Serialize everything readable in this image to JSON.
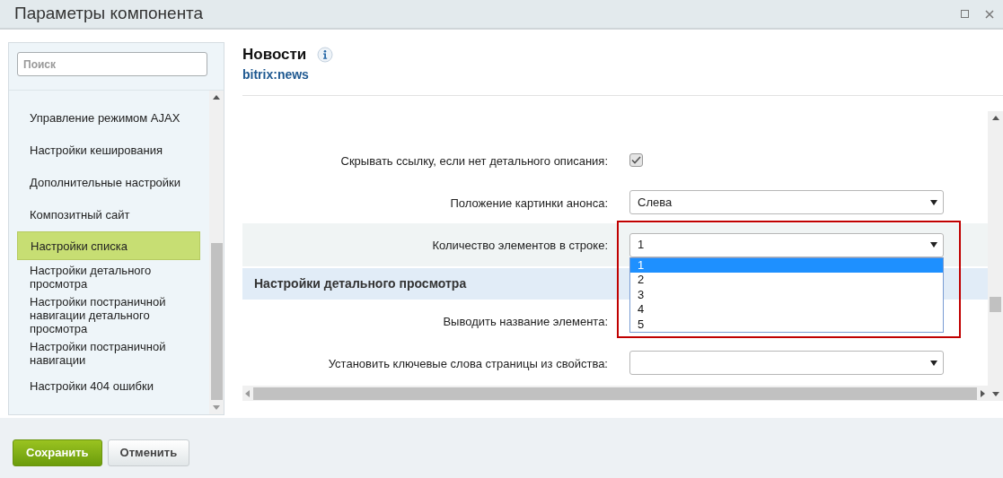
{
  "window": {
    "title": "Параметры компонента"
  },
  "sidebar": {
    "search": {
      "placeholder": "Поиск"
    },
    "items": [
      {
        "label": "Управление режимом AJAX",
        "selected": false
      },
      {
        "label": "Настройки кеширования",
        "selected": false
      },
      {
        "label": "Дополнительные настройки",
        "selected": false
      },
      {
        "label": "Композитный сайт",
        "selected": false
      },
      {
        "label": "Настройки списка",
        "selected": true
      },
      {
        "label": "Настройки детального просмотра",
        "selected": false
      },
      {
        "label": "Настройки постраничной навигации детального просмотра",
        "selected": false
      },
      {
        "label": "Настройки постраничной навигации",
        "selected": false
      },
      {
        "label": "Настройки 404 ошибки",
        "selected": false
      }
    ]
  },
  "component": {
    "title": "Новости",
    "code": "bitrix:news"
  },
  "rows": [
    {
      "kind": "checkbox",
      "label": "Скрывать ссылку, если нет детального описания:",
      "checked": true
    },
    {
      "kind": "select",
      "label": "Положение картинки анонса:",
      "value": "Слева"
    },
    {
      "kind": "select",
      "label": "Количество элементов в строке:",
      "value": "1",
      "highlighted": true,
      "open": true,
      "options": [
        {
          "label": "1",
          "selected": true
        },
        {
          "label": "2",
          "selected": false
        },
        {
          "label": "3",
          "selected": false
        },
        {
          "label": "4",
          "selected": false
        },
        {
          "label": "5",
          "selected": false
        }
      ]
    },
    {
      "kind": "section",
      "label": "Настройки детального просмотра"
    },
    {
      "kind": "covered",
      "label": "Выводить название элемента:"
    },
    {
      "kind": "select",
      "label": "Установить ключевые слова страницы из свойства:",
      "value": ""
    },
    {
      "kind": "cut"
    }
  ],
  "buttons": [
    {
      "label": "Сохранить",
      "kind": "primary"
    },
    {
      "label": "Отменить",
      "kind": "secondary"
    }
  ]
}
